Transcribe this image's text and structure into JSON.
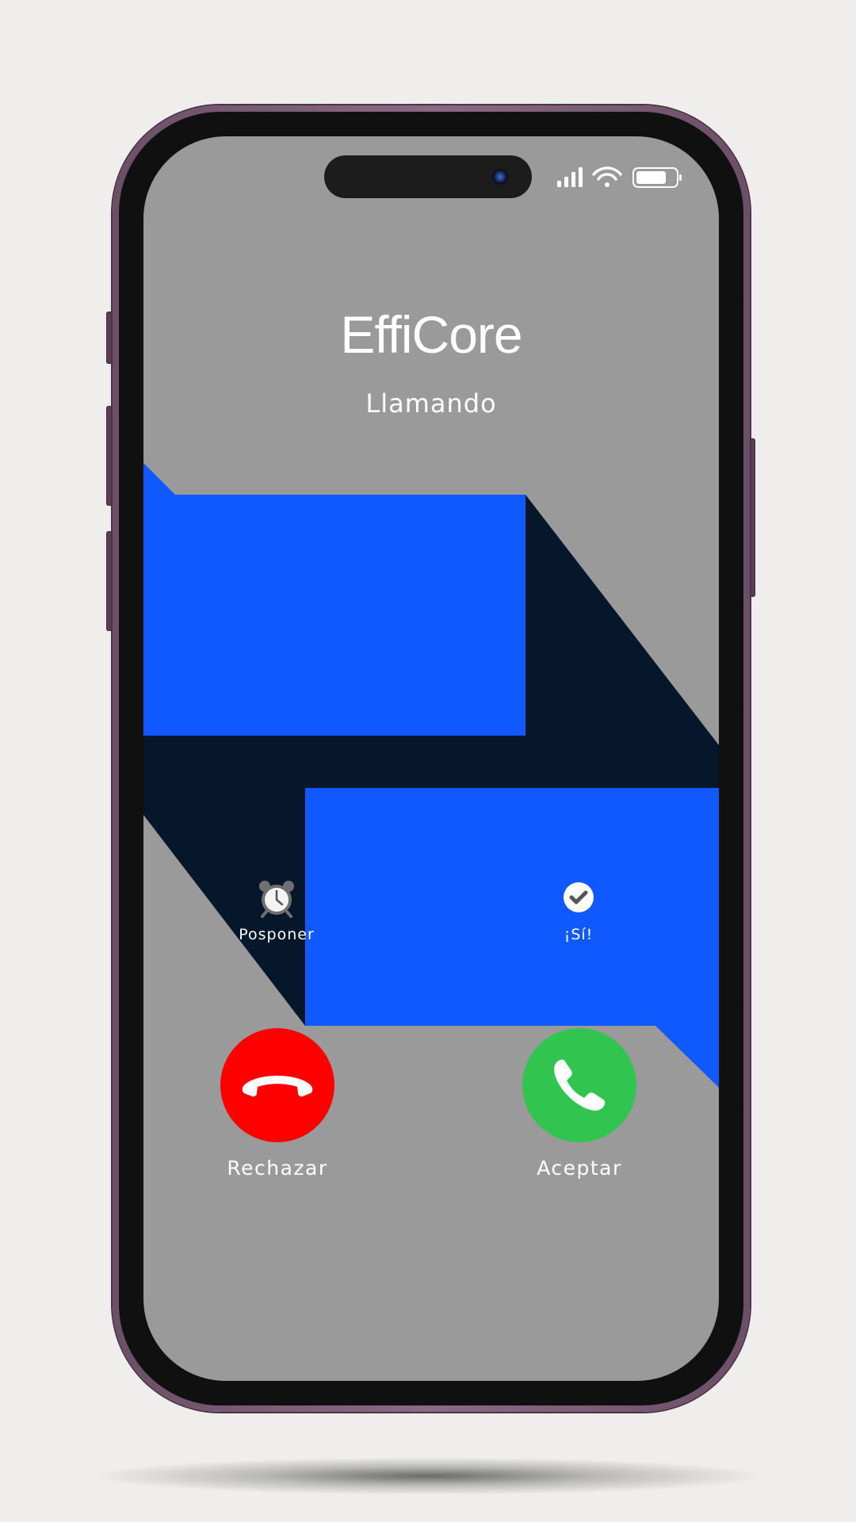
{
  "call": {
    "caller_name": "EffiCore",
    "status": "Llamando"
  },
  "quick_actions": {
    "remind": {
      "label": "Posponer",
      "icon": "alarm-clock-icon"
    },
    "message": {
      "label": "¡Sí!",
      "icon": "checkmark-icon"
    }
  },
  "actions": {
    "decline": {
      "label": "Rechazar",
      "icon": "hang-up-icon",
      "color": "#fe0000"
    },
    "accept": {
      "label": "Aceptar",
      "icon": "phone-icon",
      "color": "#31c550"
    }
  },
  "status_bar": {
    "icons": [
      "cellular-signal-icon",
      "wifi-icon",
      "battery-icon"
    ]
  },
  "colors": {
    "screen_background": "#9a9a9a",
    "brand_blue": "#1058ff",
    "brand_navy": "#06172b"
  }
}
